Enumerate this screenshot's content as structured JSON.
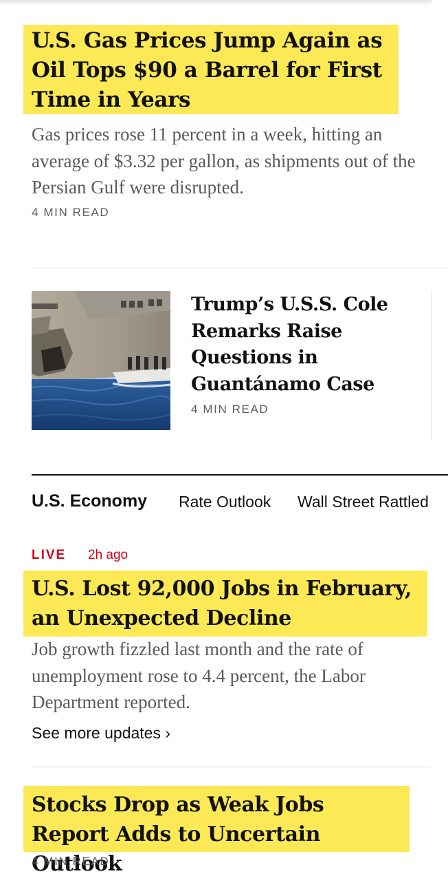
{
  "story1": {
    "headline": "U.S. Gas Prices Jump Again as Oil Tops $90 a Barrel for First Time in Years",
    "summary": "Gas prices rose 11 percent in a week, hitting an average of $3.32 per gallon, as shipments out of the Persian Gulf were disrupted.",
    "read_time": "4 MIN READ"
  },
  "story2": {
    "headline": "Trump’s U.S.S. Cole Remarks Raise Questions in Guantánamo Case",
    "read_time": "4 MIN READ",
    "image_alt": "ship-photo"
  },
  "topics": {
    "main": "U.S. Economy",
    "links": [
      "Rate Outlook",
      "Wall Street Rattled"
    ]
  },
  "story3": {
    "live_label": "LIVE",
    "time_ago": "2h ago",
    "headline": "U.S. Lost 92,000 Jobs in February, an Unexpected Decline",
    "summary": "Job growth fizzled last month and the rate of unemployment rose to 4.4 percent, the Labor Department reported.",
    "see_more": "See more updates ›"
  },
  "story4": {
    "headline": "Stocks Drop as Weak Jobs Report Adds to Uncertain Outlook",
    "read_time": "4 MIN READ"
  },
  "colors": {
    "highlight": "#fde955",
    "live_red": "#d0021b",
    "muted_text": "#5a5a5a"
  }
}
